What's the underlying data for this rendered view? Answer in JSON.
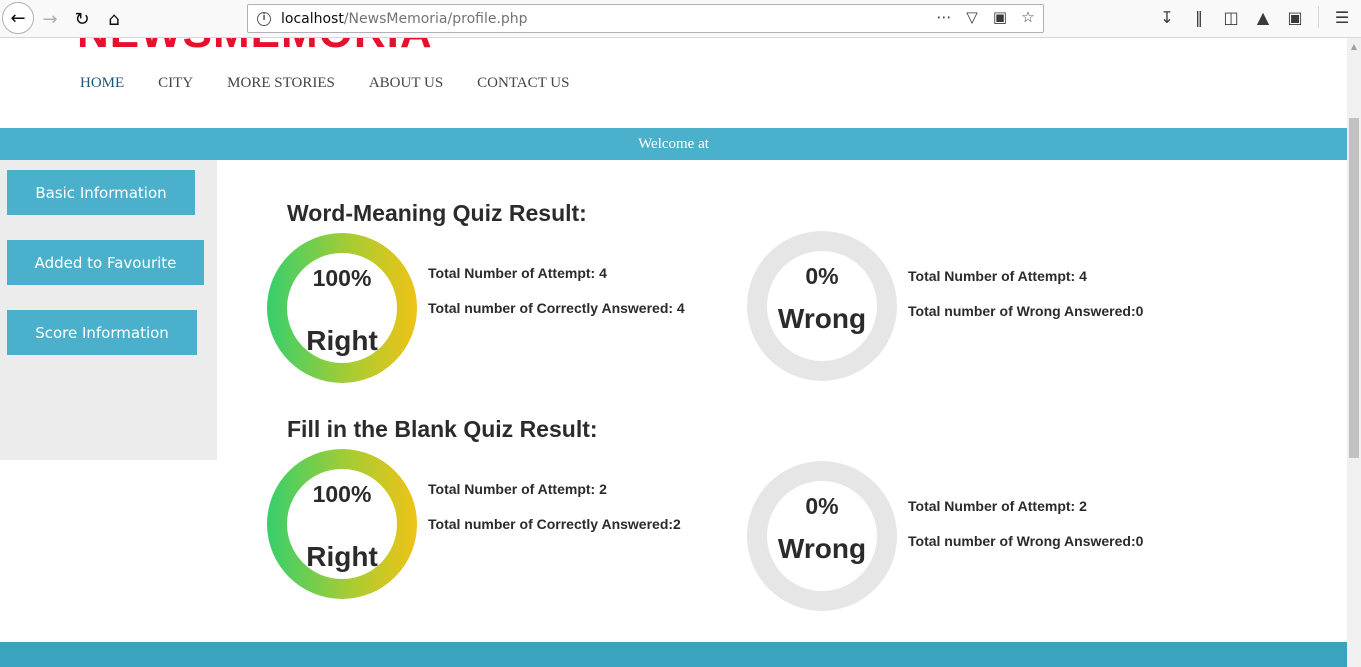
{
  "browser": {
    "url_host": "localhost",
    "url_path": "/NewsMemoria/profile.php"
  },
  "site": {
    "logo": "NEWSMEMORIA",
    "menu": [
      "HOME",
      "CITY",
      "MORE STORIES",
      "ABOUT US",
      "CONTACT US"
    ],
    "welcome": "Welcome at"
  },
  "sidebar": {
    "items": [
      "Basic Information",
      "Added to Favourite",
      "Score Information"
    ]
  },
  "word_meaning": {
    "title": "Word-Meaning Quiz Result:",
    "right_pct": "100%",
    "right_label": "Right",
    "right_stat_attempts": "Total Number of Attempt: 4",
    "right_stat_correct": "Total number of Correctly Answered: 4",
    "wrong_pct": "0%",
    "wrong_label": "Wrong",
    "wrong_stat_attempts": "Total Number of Attempt: 4",
    "wrong_stat_wrong": "Total number of Wrong Answered:0"
  },
  "fill_blank": {
    "title": "Fill in the Blank Quiz Result:",
    "right_pct": "100%",
    "right_label": "Right",
    "right_stat_attempts": "Total Number of Attempt: 2",
    "right_stat_correct": "Total number of Correctly Answered:2",
    "wrong_pct": "0%",
    "wrong_label": "Wrong",
    "wrong_stat_attempts": "Total Number of Attempt: 2",
    "wrong_stat_wrong": "Total number of Wrong Answered:0"
  },
  "colors": {
    "accent": "#4bb0cc",
    "logo": "#e8112d",
    "ring_right_start": "#36cf6c",
    "ring_right_end": "#efc316",
    "ring_wrong": "#e6e6e6"
  }
}
